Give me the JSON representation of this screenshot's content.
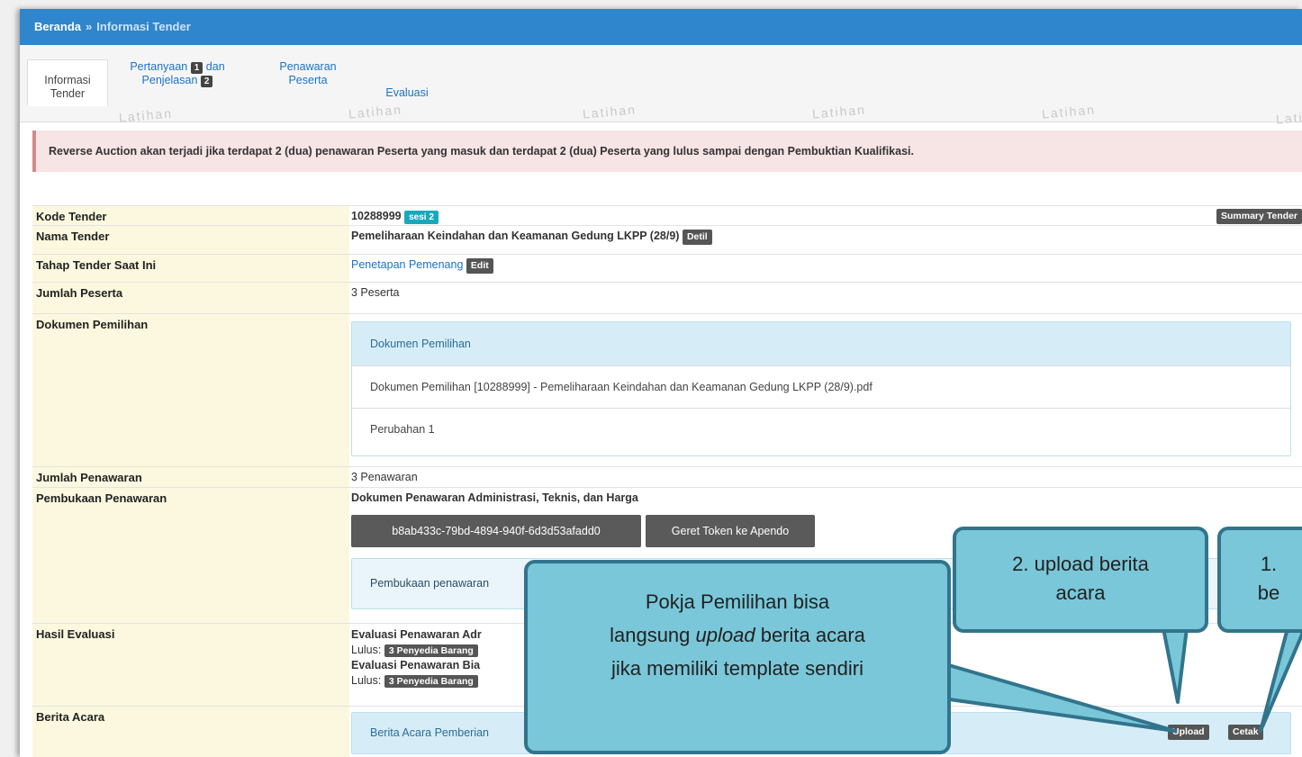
{
  "breadcrumb": {
    "home": "Beranda",
    "separator": "»",
    "current": "Informasi Tender"
  },
  "tabs": {
    "informasi_line1": "Informasi",
    "informasi_line2": "Tender",
    "pertanyaan_line1_a": "Pertanyaan",
    "pertanyaan_badge1": "1",
    "pertanyaan_line1_b": "dan",
    "pertanyaan_line2": "Penjelasan",
    "pertanyaan_badge2": "2",
    "penawaran_line1": "Penawaran",
    "penawaran_line2": "Peserta",
    "evaluasi": "Evaluasi"
  },
  "watermark": "Latihan",
  "alert": "Reverse Auction akan terjadi jika terdapat 2 (dua) penawaran Peserta yang masuk dan terdapat 2 (dua) Peserta yang lulus sampai dengan Pembuktian Kualifikasi.",
  "rows": {
    "kode": {
      "label": "Kode Tender",
      "value": "10288999",
      "sesi": "sesi 2",
      "summary_btn": "Summary Tender"
    },
    "nama": {
      "label": "Nama Tender",
      "value": "Pemeliharaan Keindahan dan Keamanan Gedung LKPP (28/9)",
      "detil_btn": "Detil"
    },
    "tahap": {
      "label": "Tahap Tender Saat Ini",
      "value": "Penetapan Pemenang",
      "edit_btn": "Edit"
    },
    "jumlah_peserta": {
      "label": "Jumlah Peserta",
      "value": "3 Peserta"
    },
    "dokumen": {
      "label": "Dokumen Pemilihan",
      "panel_title": "Dokumen Pemilihan",
      "file": "Dokumen Pemilihan [10288999] - Pemeliharaan Keindahan dan Keamanan Gedung LKPP (28/9).pdf",
      "perubahan": "Perubahan 1"
    },
    "jumlah_penawaran": {
      "label": "Jumlah Penawaran",
      "value": "3 Penawaran"
    },
    "pembukaan": {
      "label": "Pembukaan Penawaran",
      "heading": "Dokumen Penawaran Administrasi, Teknis, dan Harga",
      "token": "b8ab433c-79bd-4894-940f-6d3d53afadd0",
      "geret_btn": "Geret Token ke Apendo",
      "note": "Pembukaan penawaran"
    },
    "hasil": {
      "label": "Hasil Evaluasi",
      "line1": "Evaluasi Penawaran Adr",
      "lulus_label": "Lulus:",
      "lulus_badge": "3 Penyedia Barang",
      "line3": "Evaluasi Penawaran Bia",
      "lulus_label2": "Lulus:",
      "lulus_badge2": "3 Penyedia Barang"
    },
    "berita": {
      "label": "Berita Acara",
      "panel_text": "Berita Acara Pemberian",
      "upload_btn": "Upload",
      "cetak_btn": "Cetak"
    }
  },
  "callouts": {
    "main_line1": "Pokja Pemilihan bisa",
    "main_line2_pre": "langsung ",
    "main_line2_italic": "upload",
    "main_line2_post": " berita acara",
    "main_line3": "jika memiliki template sendiri",
    "upload_line1": "2. upload berita",
    "upload_line2": "acara",
    "cetak_line1": "1.",
    "cetak_line2": "be"
  }
}
